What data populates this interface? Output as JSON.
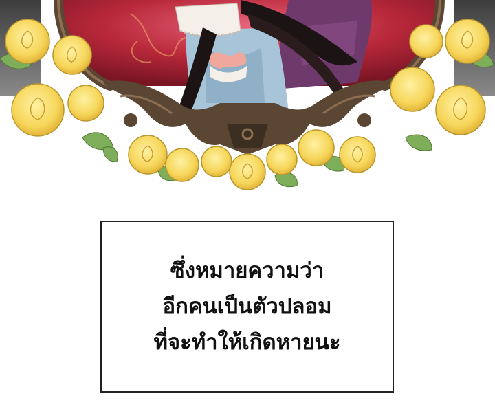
{
  "colors": {
    "background": "#ffffff",
    "text": "#111111",
    "border": "#222222",
    "rose": "#f6d65a",
    "rose_shade": "#e2b53a",
    "leaf": "#7fae5a",
    "frame": "#5b4634",
    "frame_light": "#8c6f52",
    "portrait_red": "#b8283a",
    "dress_blue": "#a7c4d8",
    "hair": "#1c1414",
    "ribbon": "#f0a79c",
    "lace": "#f4efe9"
  },
  "icons": {
    "artwork": "rose-mirror-frame-illustration"
  },
  "caption": {
    "lines": [
      "ซึ่งหมายความว่า",
      "อีกคนเป็นตัวปลอม",
      "ที่จะทำให้เกิดหายนะ"
    ]
  }
}
